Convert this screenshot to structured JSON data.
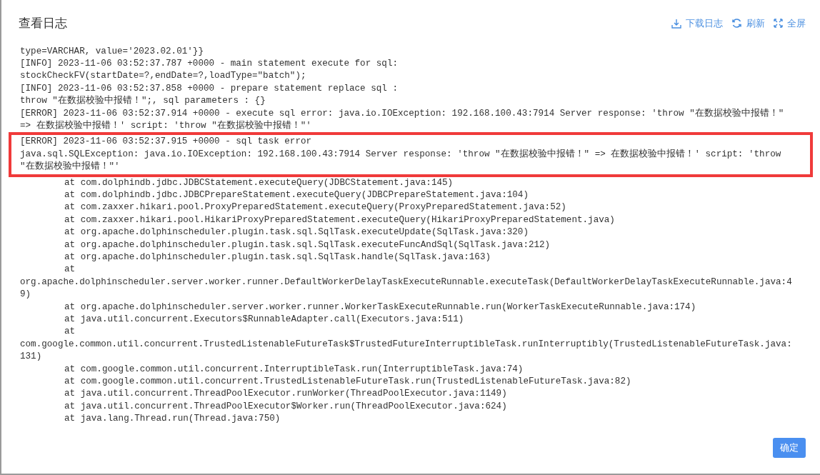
{
  "dialog": {
    "title": "查看日志"
  },
  "actions": [
    {
      "kind": "download",
      "label": "下载日志"
    },
    {
      "kind": "refresh",
      "label": "刷新"
    },
    {
      "kind": "fullscreen",
      "label": "全屏"
    }
  ],
  "log_blocks": [
    {
      "highlighted": false,
      "lines": [
        {
          "kind": "text",
          "text": "type=VARCHAR, value='2023.02.01'}}"
        },
        {
          "kind": "text",
          "text": "[INFO] 2023-11-06 03:52:37.787 +0000 - main statement execute for sql:"
        },
        {
          "kind": "text",
          "text": "stockCheckFV(startDate=?,endDate=?,loadType=\"batch\");"
        },
        {
          "kind": "text",
          "text": "[INFO] 2023-11-06 03:52:37.858 +0000 - prepare statement replace sql :"
        },
        {
          "kind": "text",
          "text": "throw \"在数据校验中报错！\";, sql parameters : {}"
        },
        {
          "kind": "text",
          "text": "[ERROR] 2023-11-06 03:52:37.914 +0000 - execute sql error: java.io.IOException: 192.168.100.43:7914 Server response: 'throw \"在数据校验中报错！\""
        },
        {
          "kind": "text",
          "text": "=> 在数据校验中报错！' script: 'throw \"在数据校验中报错！\"'"
        }
      ]
    },
    {
      "highlighted": true,
      "lines": [
        {
          "kind": "text",
          "text": "[ERROR] 2023-11-06 03:52:37.915 +0000 - sql task error"
        },
        {
          "kind": "text",
          "text": "java.sql.SQLException: java.io.IOException: 192.168.100.43:7914 Server response: 'throw \"在数据校验中报错！\" => 在数据校验中报错！' script: 'throw"
        },
        {
          "kind": "text",
          "text": "\"在数据校验中报错！\"'"
        }
      ]
    },
    {
      "highlighted": false,
      "lines": [
        {
          "kind": "frame",
          "text": "at com.dolphindb.jdbc.JDBCStatement.executeQuery(JDBCStatement.java:145)"
        },
        {
          "kind": "frame",
          "text": "at com.dolphindb.jdbc.JDBCPrepareStatement.executeQuery(JDBCPrepareStatement.java:104)"
        },
        {
          "kind": "frame",
          "text": "at com.zaxxer.hikari.pool.ProxyPreparedStatement.executeQuery(ProxyPreparedStatement.java:52)"
        },
        {
          "kind": "frame",
          "text": "at com.zaxxer.hikari.pool.HikariProxyPreparedStatement.executeQuery(HikariProxyPreparedStatement.java)"
        },
        {
          "kind": "frame",
          "text": "at org.apache.dolphinscheduler.plugin.task.sql.SqlTask.executeUpdate(SqlTask.java:320)"
        },
        {
          "kind": "frame",
          "text": "at org.apache.dolphinscheduler.plugin.task.sql.SqlTask.executeFuncAndSql(SqlTask.java:212)"
        },
        {
          "kind": "frame",
          "text": "at org.apache.dolphinscheduler.plugin.task.sql.SqlTask.handle(SqlTask.java:163)"
        },
        {
          "kind": "frame",
          "text": "at"
        },
        {
          "kind": "text",
          "text": "org.apache.dolphinscheduler.server.worker.runner.DefaultWorkerDelayTaskExecuteRunnable.executeTask(DefaultWorkerDelayTaskExecuteRunnable.java:4"
        },
        {
          "kind": "text",
          "text": "9)"
        },
        {
          "kind": "frame",
          "text": "at org.apache.dolphinscheduler.server.worker.runner.WorkerTaskExecuteRunnable.run(WorkerTaskExecuteRunnable.java:174)"
        },
        {
          "kind": "frame",
          "text": "at java.util.concurrent.Executors$RunnableAdapter.call(Executors.java:511)"
        },
        {
          "kind": "frame",
          "text": "at"
        },
        {
          "kind": "text",
          "text": "com.google.common.util.concurrent.TrustedListenableFutureTask$TrustedFutureInterruptibleTask.runInterruptibly(TrustedListenableFutureTask.java:"
        },
        {
          "kind": "text",
          "text": "131)"
        },
        {
          "kind": "frame",
          "text": "at com.google.common.util.concurrent.InterruptibleTask.run(InterruptibleTask.java:74)"
        },
        {
          "kind": "frame",
          "text": "at com.google.common.util.concurrent.TrustedListenableFutureTask.run(TrustedListenableFutureTask.java:82)"
        },
        {
          "kind": "frame",
          "text": "at java.util.concurrent.ThreadPoolExecutor.runWorker(ThreadPoolExecutor.java:1149)"
        },
        {
          "kind": "frame",
          "text": "at java.util.concurrent.ThreadPoolExecutor$Worker.run(ThreadPoolExecutor.java:624)"
        },
        {
          "kind": "frame",
          "text": "at java.lang.Thread.run(Thread.java:750)"
        }
      ]
    }
  ],
  "buttons": [
    {
      "label": "确定"
    }
  ]
}
